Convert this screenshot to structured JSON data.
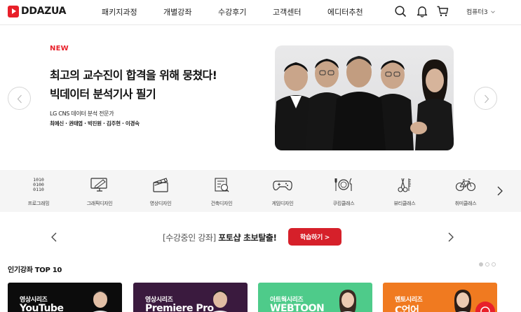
{
  "brand": {
    "name": "DDAZUA",
    "accent": "#e8202a"
  },
  "nav": {
    "items": [
      "패키지과정",
      "개별강좌",
      "수강후기",
      "고객센터",
      "에디터추천"
    ]
  },
  "header_icons": [
    "search-icon",
    "bell-icon",
    "cart-icon"
  ],
  "user": {
    "name": "컴퓨터3"
  },
  "hero": {
    "badge": "NEW",
    "title_line1": "최고의 교수진이 합격을 위해 뭉쳤다!",
    "title_line2": "빅데이터 분석기사 필기",
    "subtitle": "LG CNS 데이터 분석 전문가",
    "instructors": "최예신 · 권태엽 · 박진원 · 김주현 · 이경숙"
  },
  "categories": [
    {
      "label": "프로그래밍",
      "icon": "binary-icon"
    },
    {
      "label": "그래픽디자인",
      "icon": "monitor-pen-icon"
    },
    {
      "label": "영상디자인",
      "icon": "clapperboard-icon"
    },
    {
      "label": "건축디자인",
      "icon": "blueprint-icon"
    },
    {
      "label": "게임디자인",
      "icon": "gamepad-icon"
    },
    {
      "label": "쿠킹클래스",
      "icon": "dish-icon"
    },
    {
      "label": "뷰티클래스",
      "icon": "scissors-icon"
    },
    {
      "label": "취미클래스",
      "icon": "bicycle-icon"
    }
  ],
  "promo": {
    "prefix": "[수강중인 강좌]",
    "highlight": "포토샵 초보탈출!",
    "button": "학습하기 >",
    "button_color": "#d6202a"
  },
  "top10": {
    "title": "인기강좌 TOP 10",
    "cards": [
      {
        "series": "영상시리즈",
        "title": "YouTube",
        "color": "#0c0c0c"
      },
      {
        "series": "영상시리즈",
        "title": "Premiere Pro",
        "color": "#3a1a3e"
      },
      {
        "series": "아트웍시리즈",
        "title": "WEBTOON",
        "color": "#4ecb8a"
      },
      {
        "series": "멘토시리즈",
        "title": "C언어",
        "color": "#f07a20"
      }
    ]
  }
}
